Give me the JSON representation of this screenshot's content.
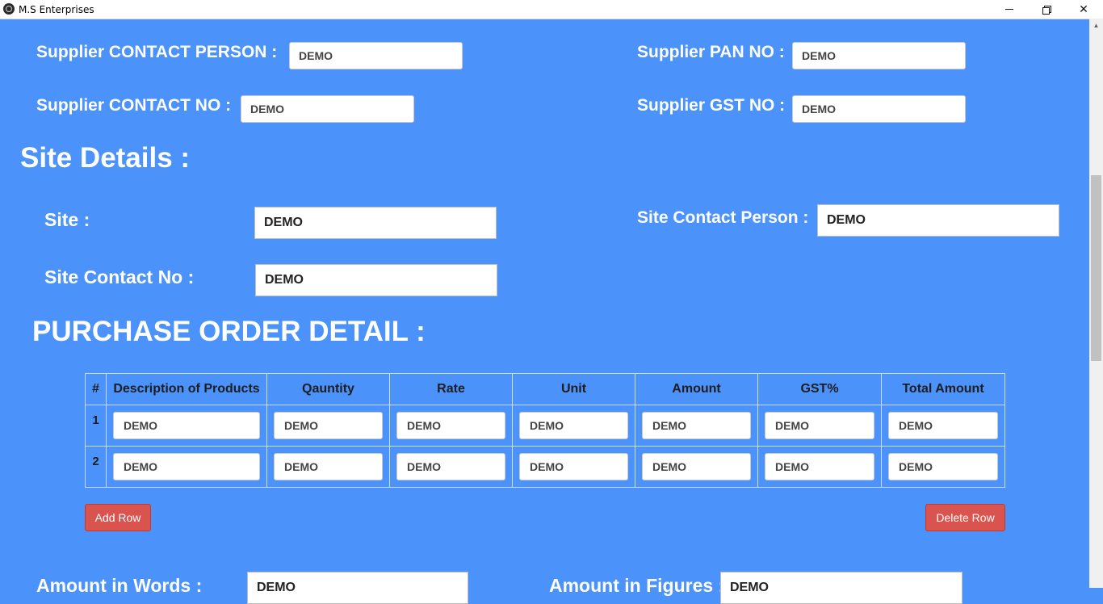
{
  "window": {
    "title": "M.S Enterprises",
    "controls": {
      "minimize": "minimize-icon",
      "restore": "restore-icon",
      "close": "✕"
    }
  },
  "supplier": {
    "contact_person_label": "Supplier CONTACT PERSON :",
    "contact_person_value": "DEMO",
    "contact_no_label": "Supplier CONTACT NO :",
    "contact_no_value": "DEMO",
    "pan_label": "Supplier PAN NO :",
    "pan_value": "DEMO",
    "gst_label": "Supplier GST NO :",
    "gst_value": "DEMO"
  },
  "site": {
    "heading": "Site Details :",
    "site_label": "Site :",
    "site_value": "DEMO",
    "contact_person_label": "Site Contact Person :",
    "contact_person_value": "DEMO",
    "contact_no_label": "Site Contact No :",
    "contact_no_value": "DEMO"
  },
  "purchase_order": {
    "heading": "PURCHASE ORDER DETAIL :",
    "columns": [
      "#",
      "Description of Products",
      "Qauntity",
      "Rate",
      "Unit",
      "Amount",
      "GST%",
      "Total Amount"
    ],
    "rows": [
      {
        "num": "1",
        "values": [
          "DEMO",
          "DEMO",
          "DEMO",
          "DEMO",
          "DEMO",
          "DEMO",
          "DEMO"
        ]
      },
      {
        "num": "2",
        "values": [
          "DEMO",
          "DEMO",
          "DEMO",
          "DEMO",
          "DEMO",
          "DEMO",
          "DEMO"
        ]
      }
    ],
    "add_row_label": "Add Row",
    "delete_row_label": "Delete Row"
  },
  "totals": {
    "amount_words_label": "Amount in Words :",
    "amount_words_value": "DEMO",
    "amount_figures_label": "Amount in Figures :",
    "amount_figures_value": "DEMO"
  },
  "colors": {
    "background": "#4b92fb",
    "button_danger": "#d9534f"
  }
}
